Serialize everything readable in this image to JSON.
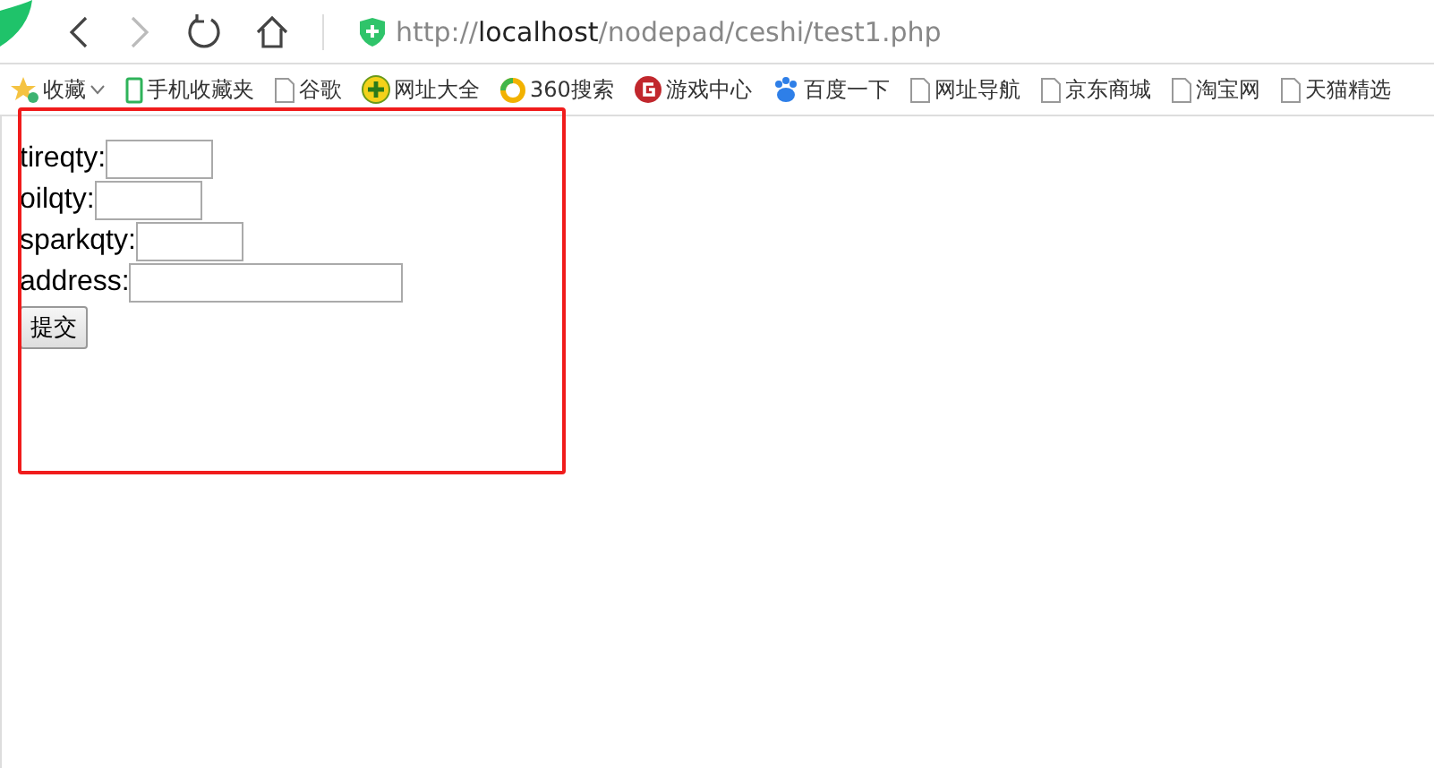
{
  "address_bar": {
    "scheme": "http://",
    "host": "localhost",
    "path": "/nodepad/ceshi/test1.php"
  },
  "bookmarks": [
    {
      "label": "收藏",
      "kind": "favorites"
    },
    {
      "label": "手机收藏夹",
      "kind": "phone"
    },
    {
      "label": "谷歌",
      "kind": "page"
    },
    {
      "label": "网址大全",
      "kind": "plus"
    },
    {
      "label": "360搜索",
      "kind": "ring"
    },
    {
      "label": "游戏中心",
      "kind": "game"
    },
    {
      "label": "百度一下",
      "kind": "paw"
    },
    {
      "label": "网址导航",
      "kind": "page"
    },
    {
      "label": "京东商城",
      "kind": "page"
    },
    {
      "label": "淘宝网",
      "kind": "page"
    },
    {
      "label": "天猫精选",
      "kind": "page"
    }
  ],
  "form": {
    "fields": [
      {
        "label": "tireqty:",
        "kind": "short"
      },
      {
        "label": "oilqty:",
        "kind": "short"
      },
      {
        "label": "sparkqty:",
        "kind": "short"
      },
      {
        "label": "address:",
        "kind": "long"
      }
    ],
    "submit": "提交"
  }
}
